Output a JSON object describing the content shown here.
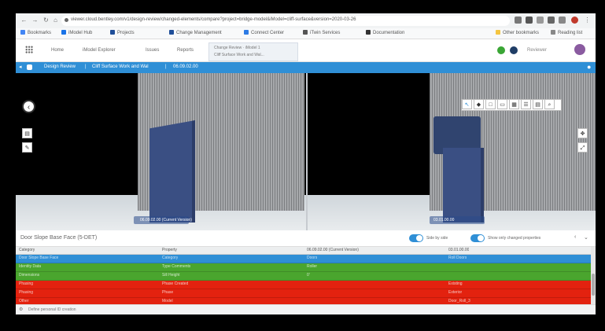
{
  "browser": {
    "url": "viewer.cloud.bentley.com/v1/design-review/changed-elements/compare?project=bridge-model&iModel=cliff-surface&version=2020-03-26",
    "bookmarks": [
      "Bookmarks",
      "iModel Hub",
      "Projects",
      "Change Management",
      "Connect Center",
      "iTwin Services",
      "Documentation",
      "Other bookmarks",
      "Reading list"
    ]
  },
  "app": {
    "tabs": [
      "Home",
      "iModel Explorer",
      "Issues",
      "Reports"
    ],
    "active_tab": [
      "Change Review · iModel 1",
      "Cliff Surface Work and Wal..."
    ],
    "user": "Reviewer"
  },
  "titlebar": {
    "segment1": "Design Review",
    "segment2": "Cliff Surface Work and Wal",
    "segment3": "06.09.02.00"
  },
  "viewport": {
    "left_label": "06.09.02.00 (Current Version)",
    "right_label": "03.01.00.00"
  },
  "grid": {
    "title": "Door Slope Base Face (5-DET)",
    "toggle1_label": "Side by side",
    "toggle2_label": "Show only changed properties",
    "columns": [
      "Category",
      "Property",
      "06.09.02.00 (Current Version)",
      "03.01.00.00"
    ],
    "rows": [
      {
        "cells": [
          "Door Slope Base Face",
          "Category",
          "Doors",
          "Roll Doors"
        ],
        "color": "#2f8fd6"
      },
      {
        "cells": [
          "Identity Data",
          "Type Comments",
          "Roller",
          ""
        ],
        "color": "#4aa52e"
      },
      {
        "cells": [
          "Dimensions",
          "Sill Height",
          "0'",
          ""
        ],
        "color": "#4aa52e"
      },
      {
        "cells": [
          "Phasing",
          "Phase Created",
          "",
          "Existing"
        ],
        "color": "#e3220f"
      },
      {
        "cells": [
          "Phasing",
          "Phase",
          "",
          "Exterior"
        ],
        "color": "#e3220f"
      },
      {
        "cells": [
          "Other",
          "Model",
          "",
          "Door_Roll_3"
        ],
        "color": "#e3220f"
      }
    ],
    "footer": "Define personal ID creation"
  }
}
